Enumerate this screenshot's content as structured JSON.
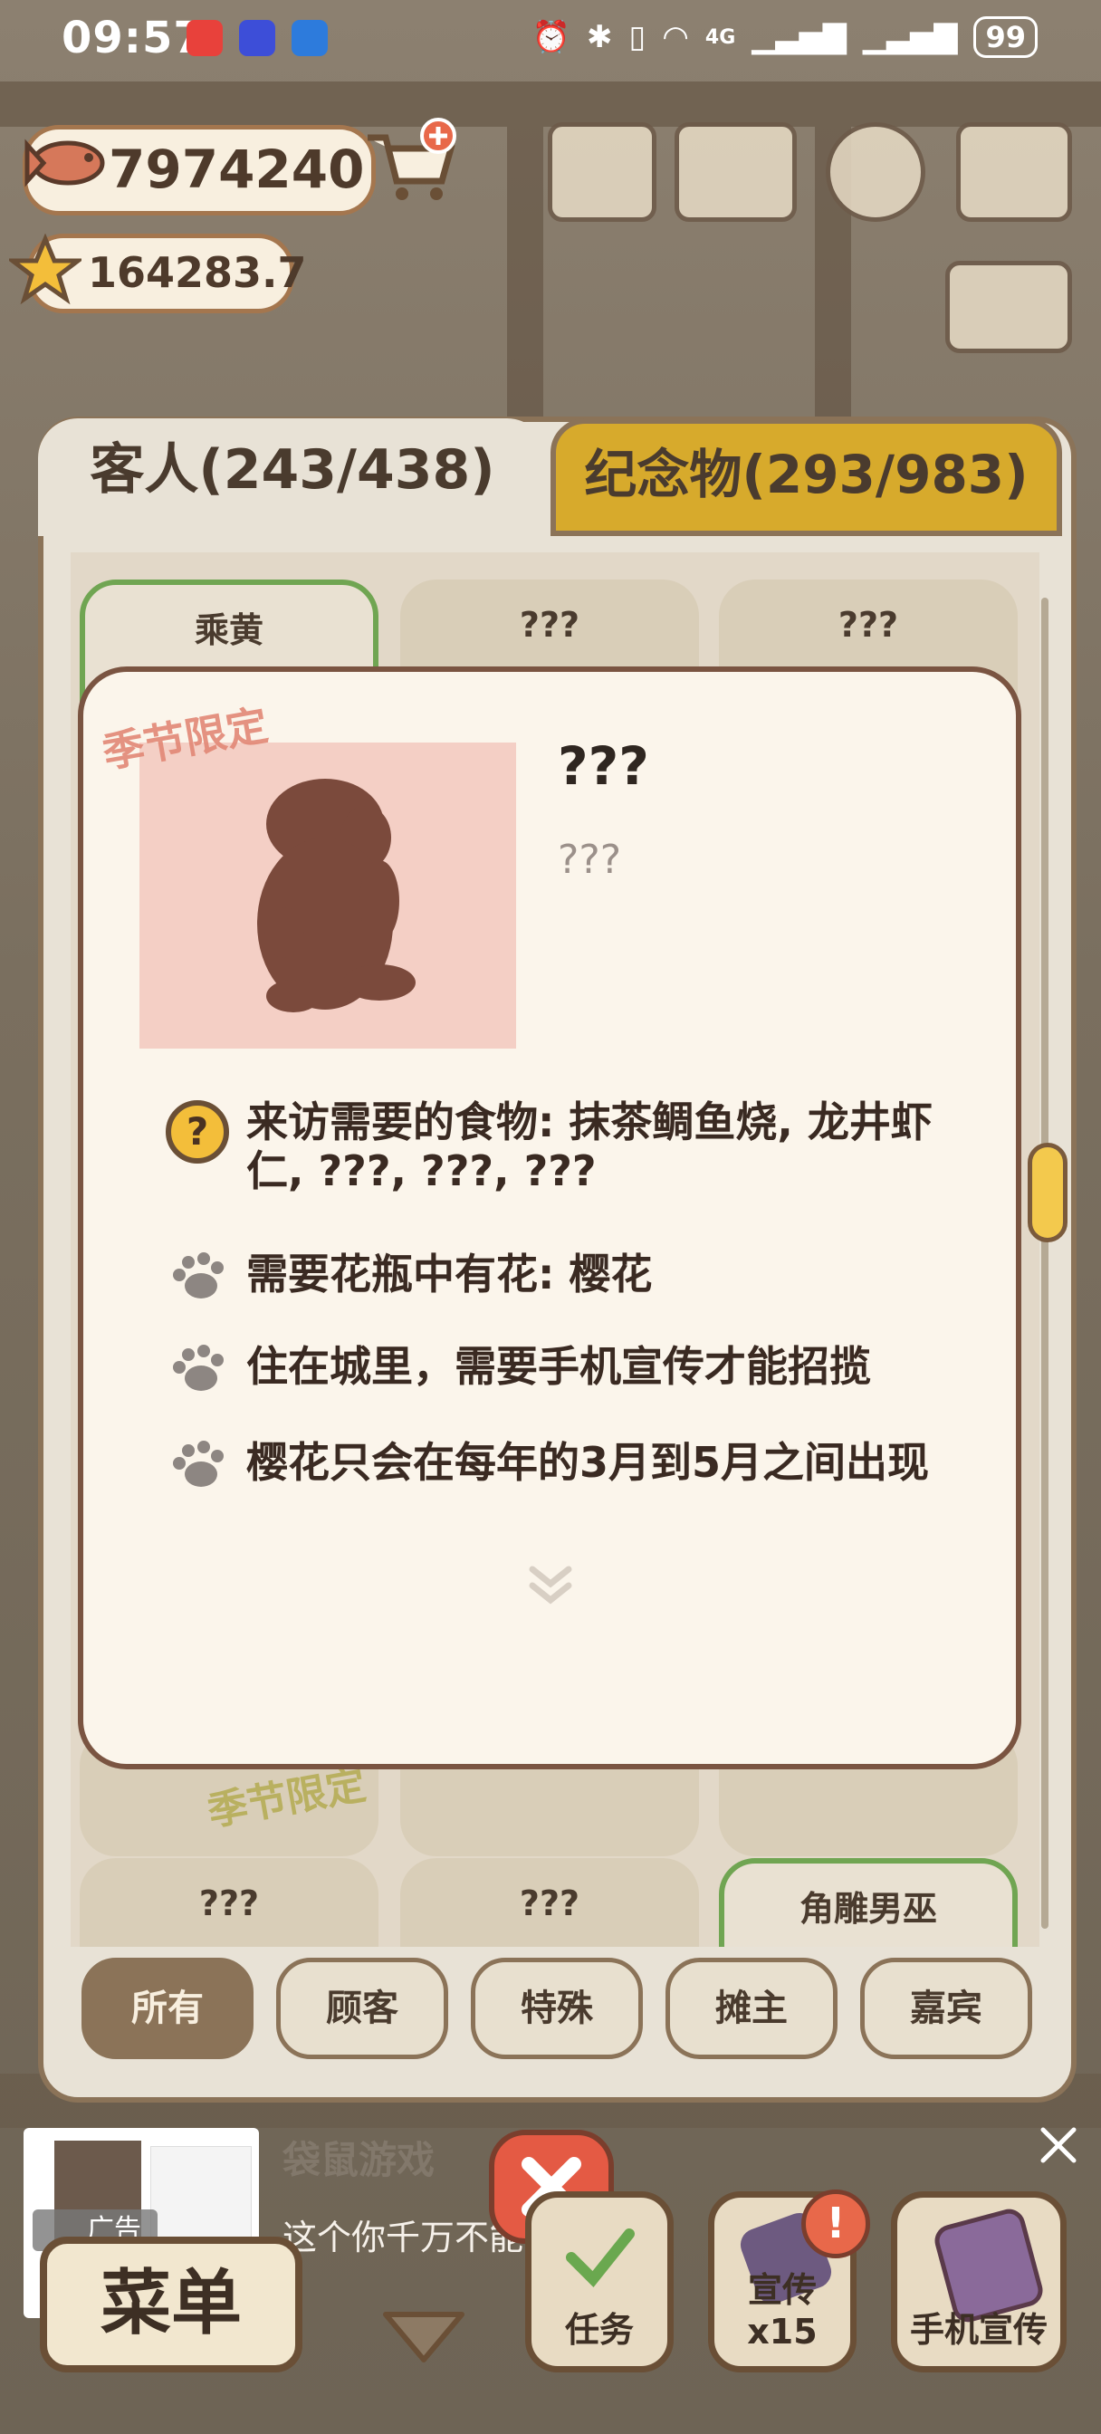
{
  "status_bar": {
    "time": "09:57",
    "app_icons": [
      {
        "name": "huawei-store-icon",
        "color": "#e8413b"
      },
      {
        "name": "tie-icon",
        "color": "#3d4ed8"
      },
      {
        "name": "lightbulb-icon",
        "color": "#2d7bdc"
      }
    ],
    "network": "4G",
    "battery": "99"
  },
  "currency": {
    "fish": "7974240",
    "stars": "164283.7"
  },
  "tabs": {
    "guests": "客人(243/438)",
    "souvenirs": "纪念物(293/983)"
  },
  "grid": {
    "row1": [
      "乘黄",
      "???",
      "???"
    ],
    "row3": [
      "???",
      "???",
      "角雕男巫"
    ],
    "seasonal_stamp": "季节限定"
  },
  "popup": {
    "seasonal_stamp": "季节限定",
    "name": "???",
    "subtitle": "???",
    "requirements": [
      {
        "icon": "question-icon",
        "text": "来访需要的食物: 抹茶鲷鱼烧, 龙井虾仁, ???, ???, ???"
      },
      {
        "icon": "paw-icon",
        "text": "需要花瓶中有花: 樱花"
      },
      {
        "icon": "paw-icon",
        "text": "住在城里，需要手机宣传才能招揽"
      },
      {
        "icon": "paw-icon",
        "text": "樱花只会在每年的3月到5月之间出现"
      }
    ]
  },
  "filters": [
    "所有",
    "顾客",
    "特殊",
    "摊主",
    "嘉宾"
  ],
  "filter_selected": "所有",
  "ad": {
    "label": "广告",
    "brand": "袋鼠游戏",
    "text": "这个你千万不能错过!"
  },
  "bottom_bar": {
    "menu": "菜单",
    "tasks": "任务",
    "promote": "宣传x15",
    "phone_promote": "手机宣传"
  },
  "colors": {
    "panel_bg": "#e8e2d6",
    "souvenir_tab": "#d7aa2c",
    "popup_bg": "#fbf5eb",
    "portrait_bg": "#f4cfc5",
    "silhouette": "#7b4a3c",
    "seasonal_text": "#e28876",
    "active_card_border": "#70a552"
  }
}
